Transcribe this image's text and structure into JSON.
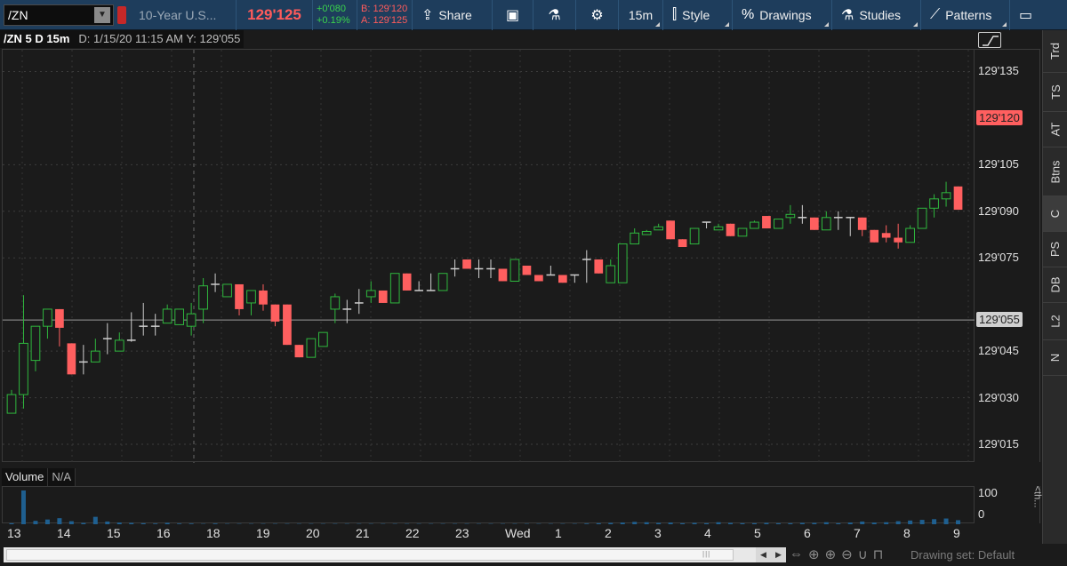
{
  "toolbar": {
    "symbol": "/ZN",
    "description": "10-Year U.S...",
    "last_price": "129'125",
    "net_change": "+0'080",
    "pct_change": "+0.19%",
    "bid": "B: 129'120",
    "ask": "A: 129'125",
    "share_label": "Share",
    "timeframe": "15m",
    "style_label": "Style",
    "drawings_label": "Drawings",
    "studies_label": "Studies",
    "patterns_label": "Patterns"
  },
  "chart_header": {
    "symbol_period": "/ZN 5 D 15m",
    "cursor_info": "D: 1/15/20 11:15 AM  Y: 129'055"
  },
  "price_axis": {
    "labels": [
      "129'135",
      "129'105",
      "129'090",
      "129'075",
      "129'045",
      "129'030",
      "129'015"
    ],
    "last_tag": "129'120",
    "cursor_tag": "129'055"
  },
  "volume": {
    "title": "Volume",
    "value": "N/A",
    "axis_labels": [
      "100",
      "0"
    ]
  },
  "side_tabs": [
    "Trd",
    "TS",
    "AT",
    "Btns",
    "C",
    "PS",
    "DB",
    "L2",
    "N"
  ],
  "bottom": {
    "drawing_set": "Drawing set: Default"
  },
  "colors": {
    "up": "#2fb83e",
    "down": "#ff5f5f",
    "doji": "#cfcfcf",
    "volume": "#1f5f8f",
    "toolbar": "#1e3d5c"
  },
  "chart_data": {
    "type": "candlestick",
    "title": "/ZN 5 D 15m",
    "price_unit": "thirty-seconds of a point",
    "ylim": [
      "129'009",
      "129'142"
    ],
    "x_tick_labels": [
      "13",
      "14",
      "15",
      "16",
      "18",
      "19",
      "20",
      "21",
      "22",
      "23",
      "Wed",
      "1",
      "2",
      "3",
      "4",
      "5",
      "6",
      "7",
      "8",
      "9"
    ],
    "candles": [
      {
        "o": 25.0,
        "h": 32.5,
        "l": 25.0,
        "c": 31.0
      },
      {
        "o": 31.0,
        "h": 63.0,
        "l": 26.5,
        "c": 47.5
      },
      {
        "o": 42.0,
        "h": 53.0,
        "l": 38.5,
        "c": 53.0
      },
      {
        "o": 53.0,
        "h": 58.5,
        "l": 49.0,
        "c": 58.5
      },
      {
        "o": 58.5,
        "h": 58.5,
        "l": 46.5,
        "c": 52.5
      },
      {
        "o": 47.5,
        "h": 47.5,
        "l": 37.5,
        "c": 37.5
      },
      {
        "o": 41.5,
        "h": 47.0,
        "l": 37.5,
        "c": 41.5
      },
      {
        "o": 41.5,
        "h": 49.0,
        "l": 41.5,
        "c": 45.0
      },
      {
        "o": 49.0,
        "h": 54.0,
        "l": 44.0,
        "c": 49.0
      },
      {
        "o": 45.0,
        "h": 51.0,
        "l": 45.0,
        "c": 48.5
      },
      {
        "o": 48.5,
        "h": 57.5,
        "l": 48.0,
        "c": 48.5
      },
      {
        "o": 53.0,
        "h": 60.5,
        "l": 50.0,
        "c": 53.0
      },
      {
        "o": 53.0,
        "h": 57.0,
        "l": 50.0,
        "c": 53.0
      },
      {
        "o": 54.0,
        "h": 60.0,
        "l": 54.0,
        "c": 58.5
      },
      {
        "o": 53.5,
        "h": 58.5,
        "l": 53.5,
        "c": 58.5
      },
      {
        "o": 53.0,
        "h": 60.5,
        "l": 50.0,
        "c": 57.0
      },
      {
        "o": 58.5,
        "h": 68.5,
        "l": 54.0,
        "c": 66.0
      },
      {
        "o": 66.5,
        "h": 70.0,
        "l": 64.0,
        "c": 66.5
      },
      {
        "o": 62.5,
        "h": 66.5,
        "l": 62.5,
        "c": 66.5
      },
      {
        "o": 66.5,
        "h": 66.5,
        "l": 56.5,
        "c": 58.5
      },
      {
        "o": 60.5,
        "h": 64.5,
        "l": 56.5,
        "c": 64.5
      },
      {
        "o": 64.5,
        "h": 66.5,
        "l": 58.0,
        "c": 60.0
      },
      {
        "o": 60.0,
        "h": 60.0,
        "l": 53.0,
        "c": 54.5
      },
      {
        "o": 60.0,
        "h": 60.0,
        "l": 47.0,
        "c": 47.0
      },
      {
        "o": 47.0,
        "h": 47.0,
        "l": 43.0,
        "c": 43.0
      },
      {
        "o": 43.0,
        "h": 49.0,
        "l": 43.0,
        "c": 49.0
      },
      {
        "o": 46.5,
        "h": 51.0,
        "l": 46.5,
        "c": 51.0
      },
      {
        "o": 58.5,
        "h": 63.5,
        "l": 54.0,
        "c": 62.5
      },
      {
        "o": 58.5,
        "h": 61.5,
        "l": 54.0,
        "c": 58.5
      },
      {
        "o": 60.5,
        "h": 65.0,
        "l": 57.0,
        "c": 60.5
      },
      {
        "o": 62.5,
        "h": 67.5,
        "l": 60.5,
        "c": 64.5
      },
      {
        "o": 64.5,
        "h": 64.5,
        "l": 60.5,
        "c": 60.5
      },
      {
        "o": 60.5,
        "h": 70.0,
        "l": 60.5,
        "c": 70.0
      },
      {
        "o": 70.0,
        "h": 70.0,
        "l": 64.5,
        "c": 64.5
      },
      {
        "o": 64.5,
        "h": 67.5,
        "l": 64.5,
        "c": 64.5
      },
      {
        "o": 64.5,
        "h": 70.0,
        "l": 64.5,
        "c": 64.5
      },
      {
        "o": 64.5,
        "h": 70.0,
        "l": 64.5,
        "c": 70.0
      },
      {
        "o": 71.5,
        "h": 74.5,
        "l": 69.0,
        "c": 71.5
      },
      {
        "o": 74.5,
        "h": 74.5,
        "l": 71.5,
        "c": 71.5
      },
      {
        "o": 71.5,
        "h": 74.5,
        "l": 68.5,
        "c": 71.5
      },
      {
        "o": 71.5,
        "h": 74.5,
        "l": 68.5,
        "c": 71.5
      },
      {
        "o": 71.5,
        "h": 71.5,
        "l": 67.5,
        "c": 67.5
      },
      {
        "o": 67.5,
        "h": 74.5,
        "l": 67.5,
        "c": 74.5
      },
      {
        "o": 72.5,
        "h": 72.5,
        "l": 69.5,
        "c": 69.5
      },
      {
        "o": 69.5,
        "h": 69.5,
        "l": 67.5,
        "c": 67.5
      },
      {
        "o": 69.5,
        "h": 72.5,
        "l": 69.5,
        "c": 69.5
      },
      {
        "o": 69.5,
        "h": 69.5,
        "l": 67.0,
        "c": 67.0
      },
      {
        "o": 69.5,
        "h": 69.5,
        "l": 67.0,
        "c": 69.5
      },
      {
        "o": 74.5,
        "h": 77.5,
        "l": 67.0,
        "c": 74.5
      },
      {
        "o": 74.5,
        "h": 74.5,
        "l": 70.0,
        "c": 70.0
      },
      {
        "o": 67.0,
        "h": 74.5,
        "l": 67.0,
        "c": 72.5
      },
      {
        "o": 67.0,
        "h": 79.5,
        "l": 67.0,
        "c": 79.5
      },
      {
        "o": 79.5,
        "h": 84.5,
        "l": 79.5,
        "c": 83.0
      },
      {
        "o": 82.5,
        "h": 84.0,
        "l": 82.5,
        "c": 83.5
      },
      {
        "o": 84.0,
        "h": 86.0,
        "l": 84.0,
        "c": 85.0
      },
      {
        "o": 87.0,
        "h": 87.0,
        "l": 81.0,
        "c": 81.0
      },
      {
        "o": 81.0,
        "h": 81.0,
        "l": 78.5,
        "c": 78.5
      },
      {
        "o": 79.5,
        "h": 84.5,
        "l": 79.5,
        "c": 84.5
      },
      {
        "o": 86.5,
        "h": 86.5,
        "l": 84.5,
        "c": 86.5
      },
      {
        "o": 84.0,
        "h": 86.0,
        "l": 84.0,
        "c": 85.0
      },
      {
        "o": 86.0,
        "h": 86.0,
        "l": 82.0,
        "c": 82.0
      },
      {
        "o": 82.0,
        "h": 84.5,
        "l": 82.0,
        "c": 84.5
      },
      {
        "o": 84.5,
        "h": 87.0,
        "l": 84.5,
        "c": 86.5
      },
      {
        "o": 88.5,
        "h": 88.5,
        "l": 84.5,
        "c": 84.5
      },
      {
        "o": 84.5,
        "h": 87.5,
        "l": 84.5,
        "c": 87.5
      },
      {
        "o": 88.0,
        "h": 92.0,
        "l": 86.0,
        "c": 89.0
      },
      {
        "o": 88.0,
        "h": 92.0,
        "l": 86.0,
        "c": 88.0
      },
      {
        "o": 88.0,
        "h": 88.0,
        "l": 84.0,
        "c": 84.0
      },
      {
        "o": 84.0,
        "h": 90.0,
        "l": 84.0,
        "c": 88.0
      },
      {
        "o": 88.0,
        "h": 90.0,
        "l": 84.0,
        "c": 88.0
      },
      {
        "o": 88.0,
        "h": 88.0,
        "l": 82.0,
        "c": 88.0
      },
      {
        "o": 88.0,
        "h": 88.0,
        "l": 82.0,
        "c": 84.0
      },
      {
        "o": 84.0,
        "h": 84.0,
        "l": 80.0,
        "c": 80.0
      },
      {
        "o": 83.0,
        "h": 85.5,
        "l": 80.0,
        "c": 81.5
      },
      {
        "o": 81.5,
        "h": 86.0,
        "l": 78.0,
        "c": 80.0
      },
      {
        "o": 80.0,
        "h": 85.5,
        "l": 80.0,
        "c": 84.5
      },
      {
        "o": 84.5,
        "h": 91.0,
        "l": 84.5,
        "c": 91.0
      },
      {
        "o": 91.0,
        "h": 95.5,
        "l": 88.0,
        "c": 94.0
      },
      {
        "o": 94.0,
        "h": 99.5,
        "l": 91.5,
        "c": 96.0
      },
      {
        "o": 98.0,
        "h": 98.0,
        "l": 90.5,
        "c": 90.5
      }
    ],
    "volume_bars": [
      3,
      100,
      10,
      14,
      18,
      9,
      4,
      22,
      8,
      5,
      4,
      3,
      2,
      4,
      2,
      2,
      1,
      2,
      1,
      1,
      1,
      1,
      1,
      1,
      1,
      1,
      1,
      1,
      1,
      1,
      1,
      1,
      1,
      1,
      1,
      1,
      1,
      1,
      1,
      1,
      1,
      1,
      1,
      1,
      1,
      1,
      1,
      1,
      2,
      3,
      4,
      5,
      7,
      6,
      4,
      5,
      3,
      4,
      3,
      6,
      4,
      3,
      3,
      4,
      3,
      3,
      4,
      4,
      6,
      3,
      5,
      8,
      5,
      6,
      9,
      11,
      13,
      15,
      17,
      12
    ]
  }
}
